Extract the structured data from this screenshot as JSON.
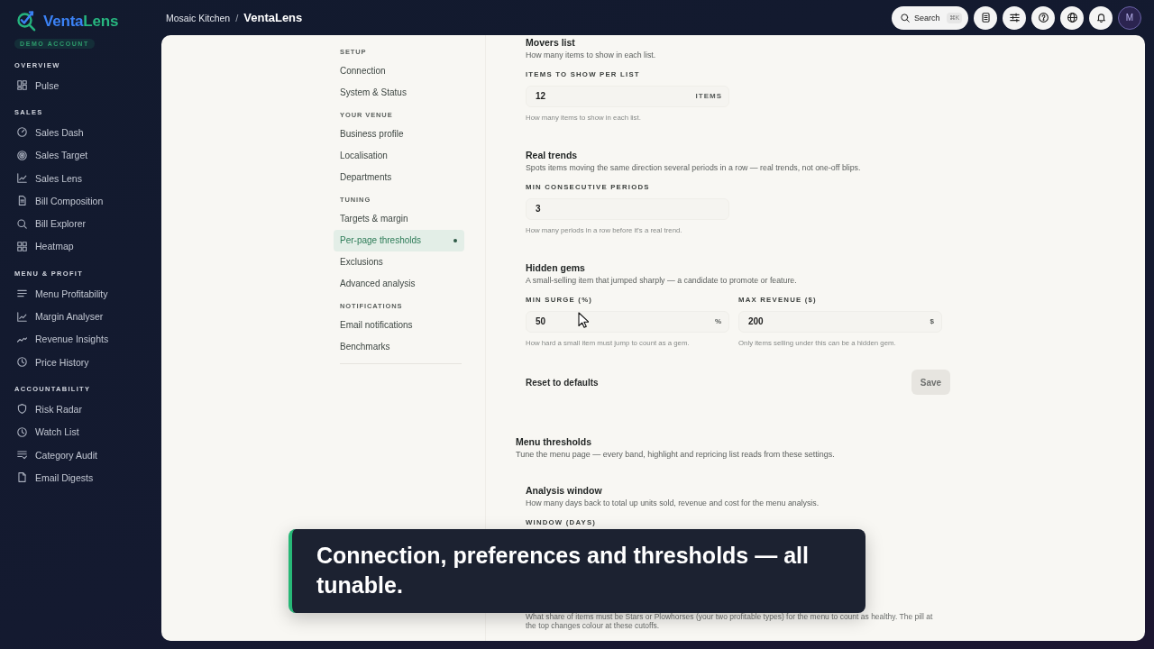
{
  "topbar": {
    "breadcrumb": [
      {
        "label": "Mosaic Kitchen"
      },
      {
        "label": "VentaLens"
      }
    ],
    "separator": "/",
    "search": {
      "label": "Search",
      "shortcut": "⌘K"
    },
    "avatar": "M"
  },
  "sidebar": {
    "logo": [
      "Venta",
      "Lens"
    ],
    "badge": "DEMO ACCOUNT",
    "sections": [
      {
        "title": "OVERVIEW",
        "items": [
          {
            "label": "Pulse",
            "selected": false
          }
        ]
      },
      {
        "title": "SALES",
        "items": [
          {
            "label": "Sales Dash",
            "selected": false
          },
          {
            "label": "Sales Target",
            "selected": false
          },
          {
            "label": "Sales Lens",
            "selected": false
          },
          {
            "label": "Bill Composition",
            "selected": false
          },
          {
            "label": "Bill Explorer",
            "selected": false
          },
          {
            "label": "Heatmap",
            "selected": false
          }
        ]
      },
      {
        "title": "MENU & PROFIT",
        "items": [
          {
            "label": "Menu Profitability",
            "selected": false
          },
          {
            "label": "Margin Analyser",
            "selected": false
          },
          {
            "label": "Revenue Insights",
            "selected": false
          },
          {
            "label": "Price History",
            "selected": false
          }
        ]
      },
      {
        "title": "ACCOUNTABILITY",
        "items": [
          {
            "label": "Risk Radar",
            "selected": false
          },
          {
            "label": "Watch List",
            "selected": false
          },
          {
            "label": "Category Audit",
            "selected": false
          },
          {
            "label": "Email Digests",
            "selected": false
          }
        ]
      }
    ]
  },
  "settings_nav": {
    "groups": [
      {
        "title": "SETUP",
        "items": [
          {
            "label": "Connection",
            "selected": false
          },
          {
            "label": "System & Status",
            "selected": false
          }
        ]
      },
      {
        "title": "YOUR VENUE",
        "items": [
          {
            "label": "Business profile",
            "selected": false
          },
          {
            "label": "Localisation",
            "selected": false
          },
          {
            "label": "Departments",
            "selected": false
          }
        ]
      },
      {
        "title": "TUNING",
        "items": [
          {
            "label": "Targets & margin",
            "selected": false
          },
          {
            "label": "Per-page thresholds",
            "selected": true
          },
          {
            "label": "Exclusions",
            "selected": false
          },
          {
            "label": "Advanced analysis",
            "selected": false
          }
        ]
      },
      {
        "title": "NOTIFICATIONS",
        "items": [
          {
            "label": "Email notifications",
            "selected": false
          },
          {
            "label": "Benchmarks",
            "selected": false
          }
        ]
      }
    ]
  },
  "content": {
    "sections": [
      {
        "subsections": [
          {
            "title": "Movers list",
            "description": "How many items to show in each list.",
            "fields": [
              {
                "label": "ITEMS TO SHOW PER LIST",
                "value": "12",
                "suffix": "ITEMS",
                "help": "How many items to show in each list."
              }
            ]
          },
          {
            "title": "Real trends",
            "description": "Spots items moving the same direction several periods in a row — real trends, not one-off blips.",
            "fields": [
              {
                "label": "MIN CONSECUTIVE PERIODS",
                "value": "3",
                "help": "How many periods in a row before it's a real trend."
              }
            ]
          },
          {
            "title": "Hidden gems",
            "description": "A small-selling item that jumped sharply — a candidate to promote or feature.",
            "fields": [
              {
                "label": "MIN SURGE (%)",
                "value": "50",
                "suffix": "%",
                "help": "How hard a small item must jump to count as a gem."
              },
              {
                "label": "MAX REVENUE ($)",
                "value": "200",
                "suffix": "$",
                "help": "Only items selling under this can be a hidden gem."
              }
            ]
          }
        ],
        "actions": {
          "reset": "Reset to defaults",
          "save": {
            "label": "Save",
            "disabled": true
          }
        }
      },
      {
        "title": "Menu thresholds",
        "description": "Tune the menu page — every band, highlight and repricing list reads from these settings.",
        "subsections": [
          {
            "title": "Analysis window",
            "description": "How many days back to total up units sold, revenue and cost for the menu analysis.",
            "fields": [
              {
                "label": "WINDOW (DAYS)"
              }
            ]
          },
          {
            "description": "What share of items must be Stars or Plowhorses (your two profitable types) for the menu to count as healthy. The pill at the top changes colour at these cutoffs."
          }
        ]
      }
    ]
  },
  "caption": "Connection, preferences and thresholds — all tunable."
}
